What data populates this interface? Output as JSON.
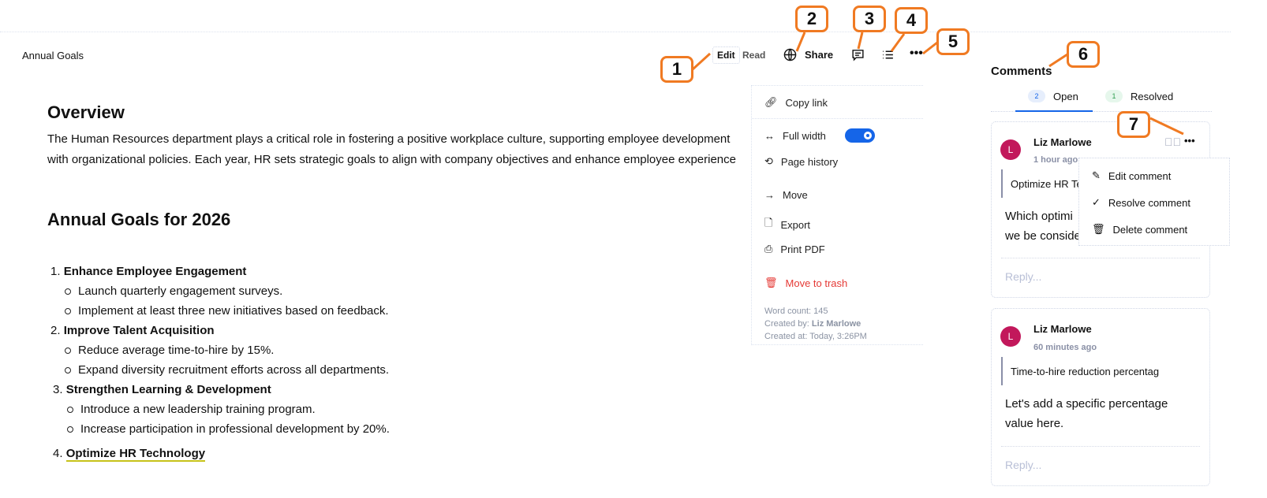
{
  "doc_title": "Annual Goals",
  "toolbar": {
    "edit": "Edit",
    "read": "Read",
    "share": "Share"
  },
  "content": {
    "h1": "Overview",
    "para": [
      "The Human Resources department plays a critical role in fostering a positive workplace culture, supporting employee development",
      "with organizational policies. Each year, HR sets strategic goals to align with company objectives and enhance employee experience"
    ],
    "h2": "Annual Goals for 2026",
    "goals": [
      {
        "num": "1.",
        "title": "Enhance Employee Engagement",
        "items": [
          "Launch quarterly engagement surveys.",
          "Implement at least three new initiatives based on feedback."
        ]
      },
      {
        "num": "2.",
        "title": "Improve Talent Acquisition",
        "items": [
          "Reduce average time-to-hire by 15%.",
          "Expand diversity recruitment efforts across all departments."
        ]
      },
      {
        "num": "3.",
        "title": "Strengthen Learning & Development",
        "items": [
          "Introduce a new leadership training program.",
          "Increase participation in professional development by 20%."
        ]
      },
      {
        "num": "4.",
        "title": "Optimize HR Technology",
        "items": []
      }
    ]
  },
  "menu": {
    "copy_link": "Copy link",
    "full_width": "Full width",
    "full_width_on": true,
    "page_history": "Page history",
    "move": "Move",
    "export": "Export",
    "print_pdf": "Print PDF",
    "trash": "Move to trash",
    "word_count": "Word count: 145",
    "created_by_label": "Created by: ",
    "created_by": "Liz Marlowe",
    "created_at": "Created at: Today, 3:26PM"
  },
  "comments": {
    "title": "Comments",
    "tabs": [
      {
        "count": "2",
        "label": "Open"
      },
      {
        "count": "1",
        "label": "Resolved"
      }
    ],
    "items": [
      {
        "initial": "L",
        "author": "Liz Marlowe",
        "time": "1 hour ago",
        "quote": "Optimize HR Technology",
        "text": [
          "Which optimi",
          "we be conside"
        ],
        "reply": "Reply..."
      },
      {
        "initial": "L",
        "author": "Liz Marlowe",
        "time": "60 minutes ago",
        "quote": "Time-to-hire reduction percentag",
        "text": [
          "Let's add a specific percentage",
          "value here."
        ],
        "reply": "Reply..."
      }
    ],
    "menu": [
      "Edit comment",
      "Resolve comment",
      "Delete comment"
    ]
  },
  "callouts": [
    "1",
    "2",
    "3",
    "4",
    "5",
    "6",
    "7"
  ],
  "colors": {
    "accent": "#1565e8",
    "danger": "#e53935",
    "callout": "#f07a22",
    "avatar": "#c2185b"
  }
}
